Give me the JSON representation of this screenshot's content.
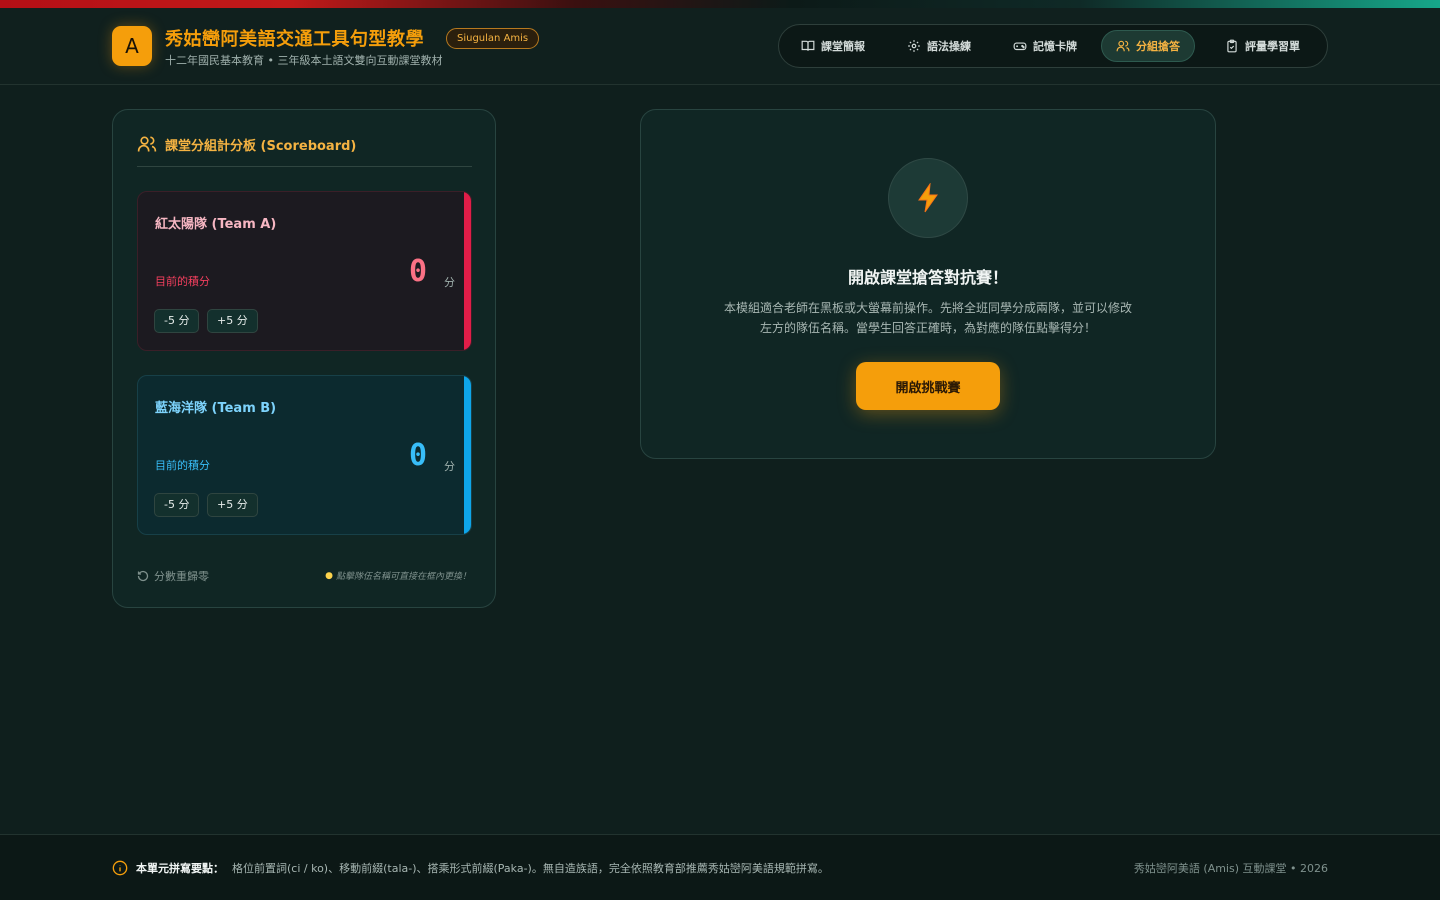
{
  "header": {
    "logo_letter": "A",
    "title": "秀姑巒阿美語交通工具句型教學",
    "badge": "Siugulan Amis",
    "subtitle": "十二年國民基本教育 • 三年級本土語文雙向互動課堂教材"
  },
  "nav": {
    "items": [
      {
        "label": "課堂簡報",
        "icon": "book-icon"
      },
      {
        "label": "語法操練",
        "icon": "gear-icon"
      },
      {
        "label": "記憶卡牌",
        "icon": "gamepad-icon"
      },
      {
        "label": "分組搶答",
        "icon": "users-icon",
        "active": true
      },
      {
        "label": "評量學習單",
        "icon": "clipboard-icon"
      }
    ]
  },
  "scoreboard": {
    "title": "課堂分組計分板 (Scoreboard)",
    "team_a": {
      "name": "紅太陽隊 (Team A)",
      "score_label": "目前的積分",
      "score": "0",
      "unit": "分",
      "minus": "-5 分",
      "plus": "+5 分"
    },
    "team_b": {
      "name": "藍海洋隊 (Team B)",
      "score_label": "目前的積分",
      "score": "0",
      "unit": "分",
      "minus": "-5 分",
      "plus": "+5 分"
    },
    "reset": "分數重歸零",
    "tip": "點擊隊伍名稱可直接在框內更換！"
  },
  "challenge": {
    "title": "開啟課堂搶答對抗賽！",
    "desc_line1": "本模組適合老師在黑板或大螢幕前操作。先將全班同學分成兩隊，並可以修改",
    "desc_line2": "左方的隊伍名稱。當學生回答正確時，為對應的隊伍點擊得分！",
    "button": "開啟挑戰賽"
  },
  "footer": {
    "key": "本單元拼寫要點：",
    "text": "格位前置詞(ci / ko)、移動前綴(tala-)、搭乘形式前綴(Paka-)。無自造族語，完全依照教育部推薦秀姑巒阿美語規範拼寫。",
    "right": "秀姑巒阿美語 (Amis) 互動課堂 • 2026"
  },
  "colors": {
    "accent": "#f59e0b",
    "team_a": "#e11d48",
    "team_b": "#0ea5e9",
    "background": "#0f1f1d"
  }
}
